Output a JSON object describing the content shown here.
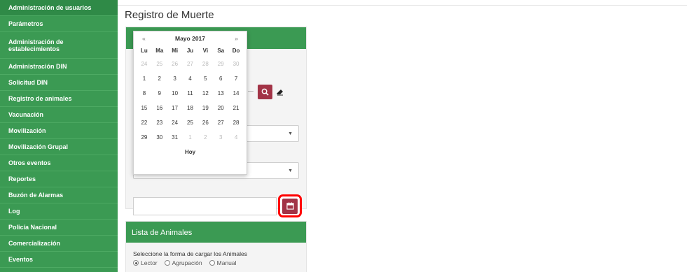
{
  "sidebar": {
    "items": [
      {
        "label": "Administración de usuarios"
      },
      {
        "label": "Parámetros"
      },
      {
        "label": "Administración de establecimientos"
      },
      {
        "label": "Administración DIN"
      },
      {
        "label": "Solicitud DIN"
      },
      {
        "label": "Registro de animales"
      },
      {
        "label": "Vacunación"
      },
      {
        "label": "Movilización"
      },
      {
        "label": "Movilización Grupal"
      },
      {
        "label": "Otros eventos"
      },
      {
        "label": "Reportes"
      },
      {
        "label": "Buzón de Alarmas"
      },
      {
        "label": "Log"
      },
      {
        "label": "Policía Nacional"
      },
      {
        "label": "Comercialización"
      },
      {
        "label": "Eventos"
      }
    ]
  },
  "page": {
    "title": "Registro de Muerte"
  },
  "datepicker": {
    "month_label": "Mayo 2017",
    "prev": "«",
    "next": "»",
    "weekdays": [
      "Lu",
      "Ma",
      "Mi",
      "Ju",
      "Vi",
      "Sa",
      "Do"
    ],
    "days": [
      [
        "24",
        "25",
        "26",
        "27",
        "28",
        "29",
        "30"
      ],
      [
        "1",
        "2",
        "3",
        "4",
        "5",
        "6",
        "7"
      ],
      [
        "8",
        "9",
        "10",
        "11",
        "12",
        "13",
        "14"
      ],
      [
        "15",
        "16",
        "17",
        "18",
        "19",
        "20",
        "21"
      ],
      [
        "22",
        "23",
        "24",
        "25",
        "26",
        "27",
        "28"
      ],
      [
        "29",
        "30",
        "31",
        "1",
        "2",
        "3",
        "4"
      ]
    ],
    "today_label": "Hoy"
  },
  "animals_panel": {
    "header": "Lista de Animales",
    "prompt": "Seleccione la forma de cargar los Animales",
    "options": [
      {
        "label": "Lector",
        "selected": true
      },
      {
        "label": "Agrupación",
        "selected": false
      },
      {
        "label": "Manual",
        "selected": false
      }
    ]
  },
  "icons": {
    "search": "search-icon",
    "eraser": "eraser-icon",
    "calendar": "calendar-icon"
  },
  "colors": {
    "sidebar": "#3b9a53",
    "accent_button": "#a23346",
    "highlight": "#ff0000"
  }
}
